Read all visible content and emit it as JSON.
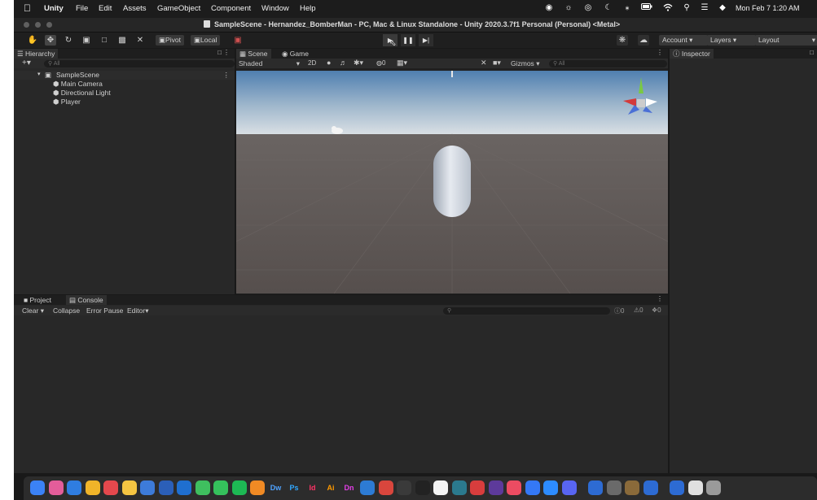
{
  "menubar": {
    "items": [
      "Unity",
      "File",
      "Edit",
      "Assets",
      "GameObject",
      "Component",
      "Window",
      "Help"
    ],
    "clock": "Mon Feb 7  1:20 AM"
  },
  "window": {
    "title": "SampleScene - Hernandez_BomberMan - PC, Mac & Linux Standalone - Unity 2020.3.7f1 Personal (Personal) <Metal>"
  },
  "toolbar": {
    "pivot_label": "Pivot",
    "local_label": "Local",
    "account_label": "Account",
    "layers_label": "Layers",
    "layout_label": "Layout"
  },
  "hierarchy": {
    "tab_label": "Hierarchy",
    "search_placeholder": "All",
    "scene_name": "SampleScene",
    "objects": [
      "Main Camera",
      "Directional Light",
      "Player"
    ]
  },
  "scene_panel": {
    "tabs": [
      "Scene",
      "Game"
    ],
    "shading_mode": "Shaded",
    "mode_2d": "2D",
    "gizmos_label": "Gizmos",
    "search_placeholder": "All",
    "hidden_count": "0"
  },
  "inspector": {
    "tab_label": "Inspector"
  },
  "bottom_panel": {
    "tabs": [
      "Project",
      "Console"
    ],
    "clear_label": "Clear",
    "collapse_label": "Collapse",
    "error_pause_label": "Error Pause",
    "editor_label": "Editor",
    "log_count": "0",
    "warning_count": "0",
    "error_count": "0"
  },
  "colors": {
    "editor_bg": "#282828",
    "sky_top": "#4f7fb0",
    "ground": "#5f5856"
  },
  "dock_apps": [
    "finder",
    "launchpad",
    "safari",
    "chrome",
    "calendar",
    "notes",
    "reminders",
    "word",
    "outlook",
    "messages",
    "facetime",
    "spotify",
    "blender",
    "Dw",
    "Ps",
    "Id",
    "Ai",
    "Dn",
    "vscode",
    "creative-cloud",
    "github",
    "unity",
    "notion",
    "mm",
    "wunderlist",
    "slack",
    "music",
    "chrome-alt",
    "zoom",
    "discord",
    "vs-1",
    "vs-2",
    "vs-3",
    "vs-4",
    "preview",
    "downloads",
    "trash"
  ]
}
